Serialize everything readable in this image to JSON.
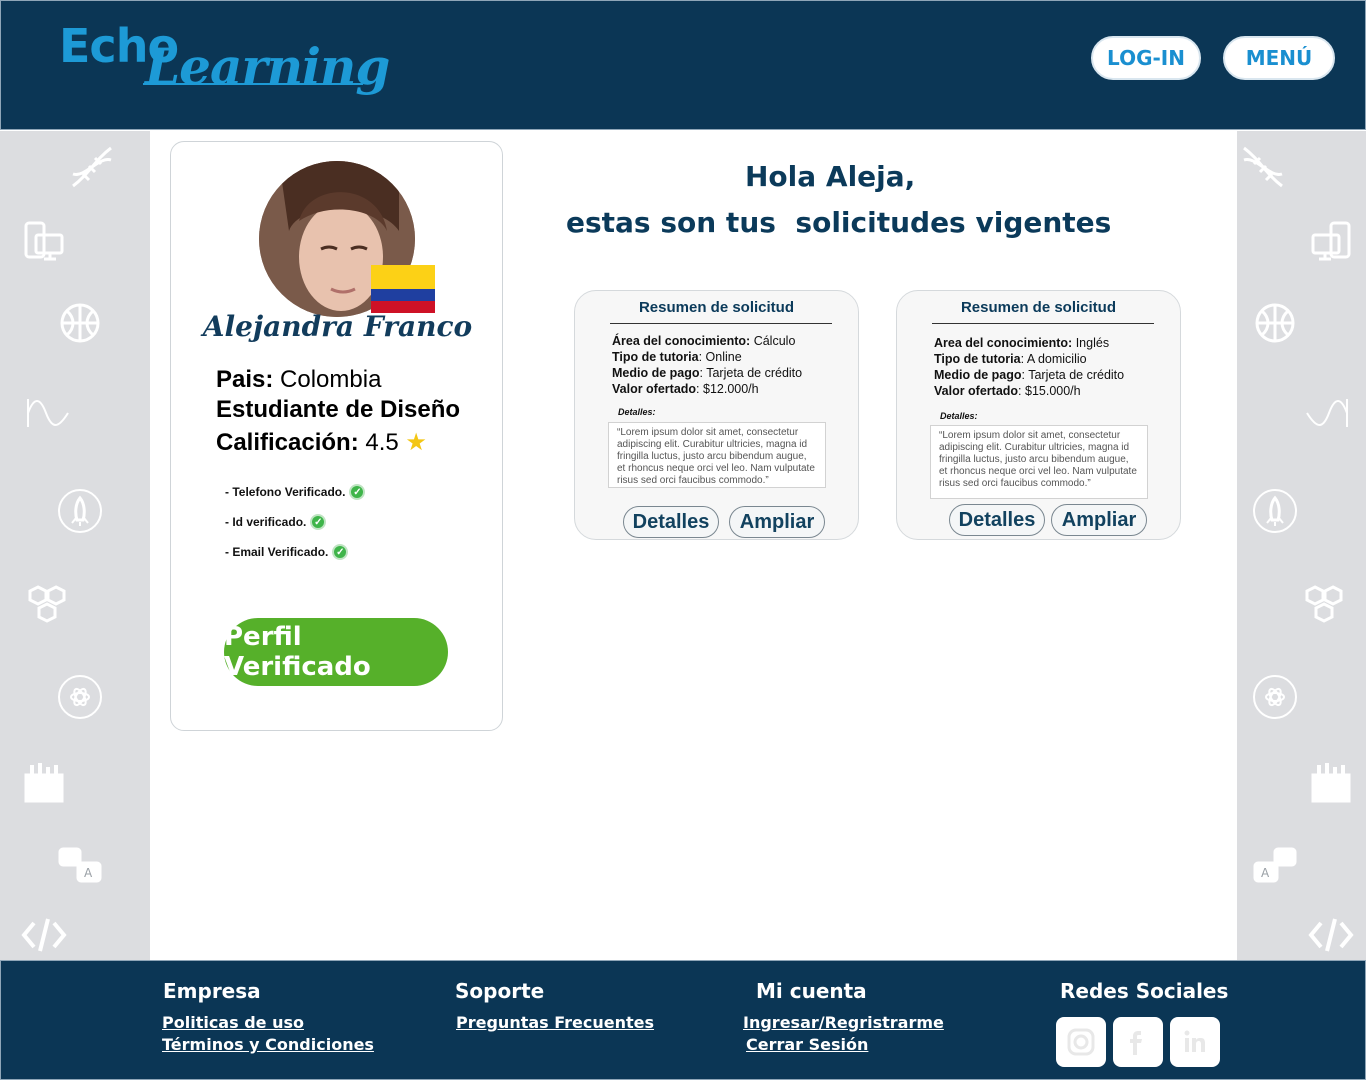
{
  "header": {
    "logo_echo": "Echo",
    "logo_learning": "Learning",
    "login_label": "LOG-IN",
    "menu_label": "MENÚ"
  },
  "profile": {
    "name": "Alejandra Franco",
    "country_label": "Pais:",
    "country": "Colombia",
    "role": "Estudiante de Diseño",
    "rating_label": "Calificación:",
    "rating": "4.5",
    "verifications": [
      "- Telefono Verificado.",
      "- Id verificado.",
      "- Email Verificado."
    ],
    "verified_button": "Perfil Verificado"
  },
  "greeting": {
    "line1": "Hola Aleja,",
    "line2": "estas son tus  solicitudes vigentes"
  },
  "requests": [
    {
      "title": "Resumen de solicitud",
      "area_label": "Área del conocimiento:",
      "area": "  Cálculo",
      "tipo_label": "Tipo de tutoria",
      "tipo": ": Online",
      "medio_label": "Medio de pago",
      "medio": ": Tarjeta de crédito",
      "valor_label": "Valor ofertado",
      "valor": ": $12.000/h",
      "details_label": "Detalles:",
      "details": "“Lorem ipsum dolor sit amet, consectetur adipiscing elit. Curabitur ultricies, magna id fringilla luctus, justo arcu bibendum augue, et rhoncus neque orci vel leo. Nam vulputate risus sed orci faucibus commodo.”",
      "btn_details": "Detalles",
      "btn_expand": "Ampliar"
    },
    {
      "title": "Resumen de solicitud",
      "area_label": "Area del conocimiento:",
      "area": " Inglés",
      "tipo_label": "Tipo de tutoria",
      "tipo": ": A domicilio",
      "medio_label": "Medio de pago",
      "medio": ": Tarjeta de crédito",
      "valor_label": "Valor ofertado",
      "valor": ": $15.000/h",
      "details_label": "Detalles:",
      "details": "“Lorem ipsum dolor sit amet, consectetur adipiscing elit. Curabitur ultricies, magna id fringilla luctus, justo arcu bibendum augue, et rhoncus neque orci vel leo. Nam vulputate risus sed orci faucibus commodo.”",
      "btn_details": "Detalles",
      "btn_expand": "Ampliar"
    }
  ],
  "footer": {
    "empresa": "Empresa",
    "politicas": "Politicas de uso",
    "terminos": "Términos y Condiciones",
    "soporte": "Soporte",
    "faq": "Preguntas Frecuentes",
    "micuenta": "Mi cuenta",
    "ingresar": "Ingresar/Regristrarme",
    "cerrar": "Cerrar Sesión",
    "redes": "Redes Sociales"
  },
  "colors": {
    "navy": "#0b3655",
    "accent_blue": "#1d9ad6",
    "verified_green": "#56b02a",
    "rail_gray": "#dcdde0"
  },
  "icons": [
    "dna-icon",
    "devices-icon",
    "basketball-icon",
    "wave-icon",
    "rocket-icon",
    "hexagons-icon",
    "atom-icon",
    "music-icon",
    "translate-icon",
    "code-icon"
  ]
}
